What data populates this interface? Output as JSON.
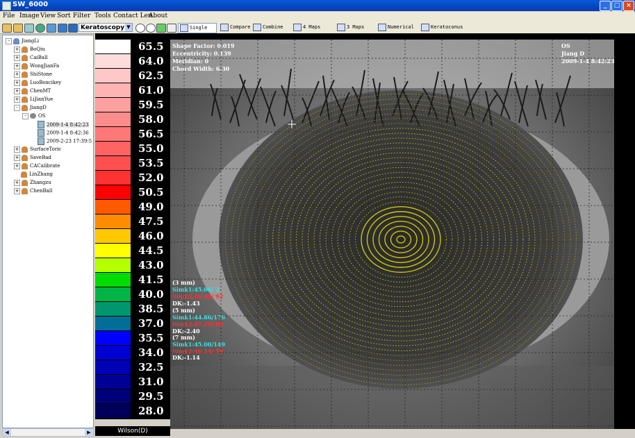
{
  "window": {
    "title": "SW_6000"
  },
  "menu": [
    "File",
    "Image",
    "View",
    "Sort",
    "Filter",
    "Tools",
    "Contact Len",
    "About"
  ],
  "toolbar": {
    "mode_select": "Keratoscopy",
    "buttons": [
      "Single",
      "Compare",
      "Combine",
      "4 Maps",
      "3 Maps",
      "Numerical",
      "Keratoconus"
    ]
  },
  "tree": {
    "root": "JiangLi",
    "patients": [
      "BoQiu",
      "CaiBall",
      "WongJianFa",
      "ShiStone",
      "LuoBoxcikey",
      "ChenMT",
      "LiJianYue",
      "JiangD",
      "SurfaceToric",
      "SaveBad",
      "CACalibrate",
      "LinZhang",
      "Zhangzu",
      "ChenBall"
    ],
    "expanded_patient": "JiangD",
    "eye": "OS",
    "exams": [
      "2009-1-4 8:42:23",
      "2009-1-4 8:42:36",
      "2009-2-23 17:39:5"
    ]
  },
  "legend": {
    "values": [
      "65.5",
      "64.0",
      "62.5",
      "61.0",
      "59.5",
      "58.0",
      "56.5",
      "55.0",
      "53.5",
      "52.0",
      "50.5",
      "49.0",
      "47.5",
      "46.0",
      "44.5",
      "43.0",
      "41.5",
      "40.0",
      "38.5",
      "37.0",
      "35.5",
      "34.0",
      "32.5",
      "31.0",
      "29.5",
      "28.0"
    ],
    "colors": [
      "#ffffff",
      "#ffdcdc",
      "#ffc8c8",
      "#ffb4b4",
      "#ffa0a0",
      "#ff8c8c",
      "#ff7878",
      "#ff6464",
      "#ff5050",
      "#ff3232",
      "#ff0000",
      "#ff5a00",
      "#ff8c00",
      "#ffc800",
      "#ffff00",
      "#b4ff00",
      "#00dc00",
      "#00b446",
      "#00966e",
      "#006e96",
      "#0000ff",
      "#0000d2",
      "#0000b4",
      "#000096",
      "#000078",
      "#00005a"
    ],
    "footer": "Wilson(D)"
  },
  "info": {
    "shape_factor": "Shape Factor: 0.019",
    "eccentricity": "Eccentricity: 0.139",
    "meridian": "Meridian: 0",
    "chord_width": "Chord Width: 6.30",
    "eye": "OS",
    "patient": "Jiang D",
    "datetime": "2009-1-4 8:42:23"
  },
  "sim": {
    "z3": {
      "label": "(3 mm)",
      "k1": "Simk1:45.06/ 2",
      "k2": "Simk2:46.49/ 92",
      "dk": "DK:-1.43"
    },
    "z5": {
      "label": "(5 mm)",
      "k1": "Simk1:44.86/176",
      "k2": "Simk2:47.25/ 86",
      "dk": "DK:-2.40"
    },
    "z7": {
      "label": "(7 mm)",
      "k1": "Simk1:45.00/149",
      "k2": "Simk2:46.14/ 59",
      "dk": "DK:-1.14"
    }
  },
  "colors": {
    "k1": "#40e0e0",
    "k2": "#ff3030",
    "dk": "#ffffff",
    "mires": "#e8e000"
  }
}
